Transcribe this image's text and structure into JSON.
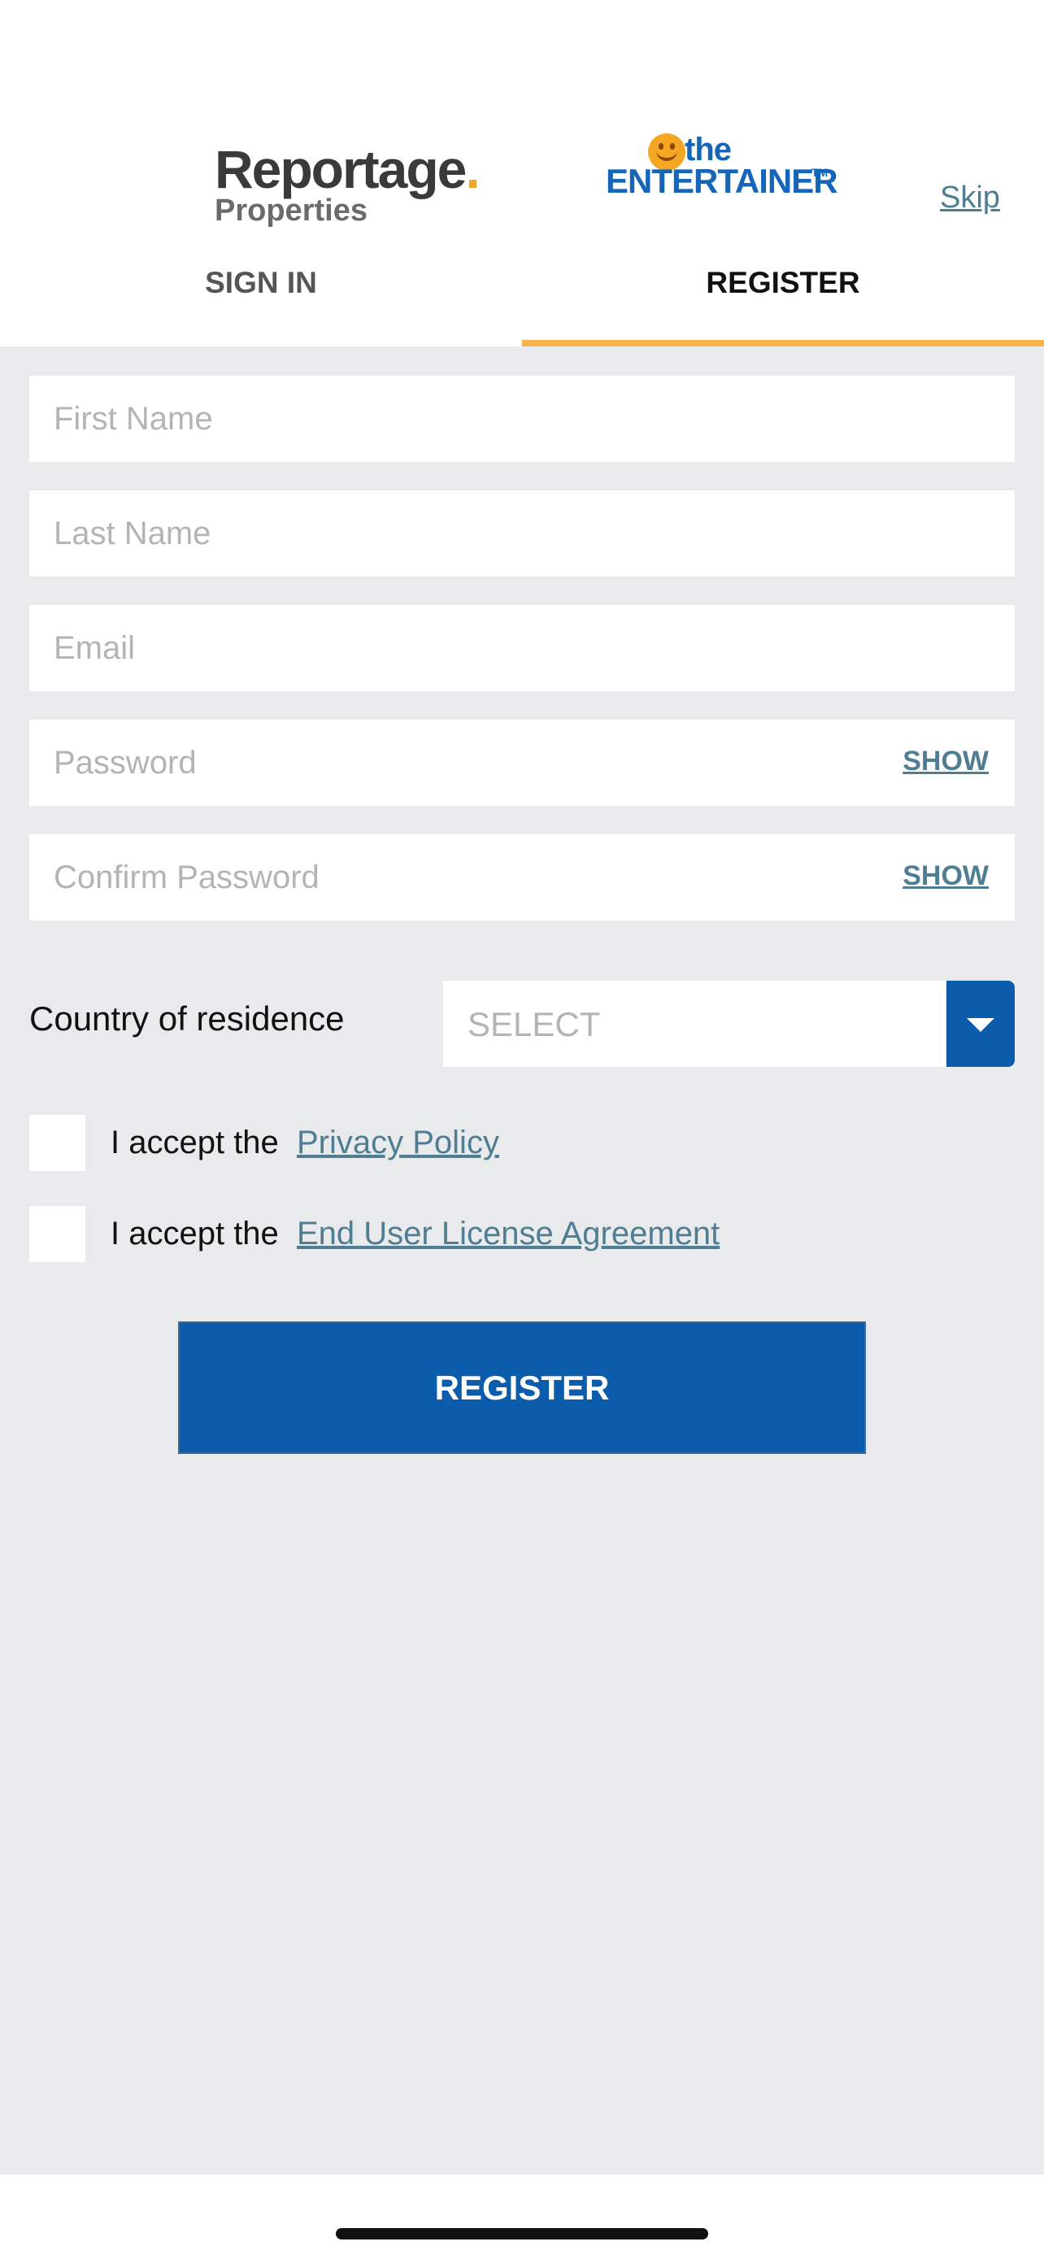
{
  "header": {
    "logo_reportage_main": "Reportage",
    "logo_reportage_dot": ".",
    "logo_reportage_sub": "Properties",
    "logo_entertainer_the": "the",
    "logo_entertainer_main": "ENTERTAINER",
    "logo_entertainer_tm": "TM",
    "skip_label": "Skip"
  },
  "tabs": {
    "sign_in": "SIGN IN",
    "register": "REGISTER",
    "active": "register"
  },
  "form": {
    "first_name": {
      "placeholder": "First Name",
      "value": ""
    },
    "last_name": {
      "placeholder": "Last Name",
      "value": ""
    },
    "email": {
      "placeholder": "Email",
      "value": ""
    },
    "password": {
      "placeholder": "Password",
      "value": "",
      "show_label": "SHOW"
    },
    "confirm_password": {
      "placeholder": "Confirm Password",
      "value": "",
      "show_label": "SHOW"
    },
    "country": {
      "label": "Country of residence",
      "selected": "SELECT"
    },
    "privacy": {
      "prefix": "I accept the",
      "link": "Privacy Policy",
      "checked": false
    },
    "eula": {
      "prefix": "I accept the",
      "link": "End User License Agreement",
      "checked": false
    },
    "submit_label": "REGISTER"
  },
  "colors": {
    "brand_blue": "#0b5dab",
    "accent_orange": "#f5b34a",
    "link_teal": "#4f7e93",
    "background": "#e9eaec"
  },
  "icons": {
    "select_arrow": "chevron-down-icon",
    "logo_smiley": "smiley-icon"
  }
}
